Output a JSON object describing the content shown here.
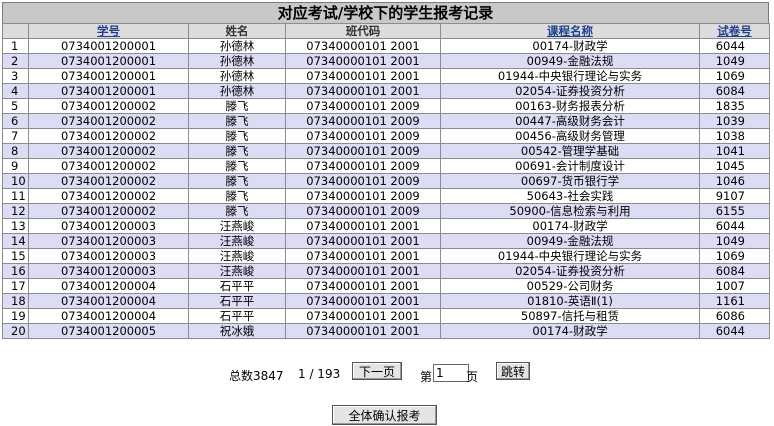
{
  "title": "对应考试/学校下的学生报考记录",
  "columns": {
    "no": "",
    "student_id": "学号",
    "name": "姓名",
    "class_code": "班代码",
    "course": "课程名称",
    "paper": "试卷号"
  },
  "rows": [
    {
      "no": "1",
      "student_id": "0734001200001",
      "name": "孙德林",
      "class_code": "07340000101 2001",
      "course": "00174-财政学",
      "paper": "6044"
    },
    {
      "no": "2",
      "student_id": "0734001200001",
      "name": "孙德林",
      "class_code": "07340000101 2001",
      "course": "00949-金融法规",
      "paper": "1049"
    },
    {
      "no": "3",
      "student_id": "0734001200001",
      "name": "孙德林",
      "class_code": "07340000101 2001",
      "course": "01944-中央银行理论与实务",
      "paper": "1069"
    },
    {
      "no": "4",
      "student_id": "0734001200001",
      "name": "孙德林",
      "class_code": "07340000101 2001",
      "course": "02054-证券投资分析",
      "paper": "6084"
    },
    {
      "no": "5",
      "student_id": "0734001200002",
      "name": "滕飞",
      "class_code": "07340000101 2009",
      "course": "00163-财务报表分析",
      "paper": "1835"
    },
    {
      "no": "6",
      "student_id": "0734001200002",
      "name": "滕飞",
      "class_code": "07340000101 2009",
      "course": "00447-高级财务会计",
      "paper": "1039"
    },
    {
      "no": "7",
      "student_id": "0734001200002",
      "name": "滕飞",
      "class_code": "07340000101 2009",
      "course": "00456-高级财务管理",
      "paper": "1038"
    },
    {
      "no": "8",
      "student_id": "0734001200002",
      "name": "滕飞",
      "class_code": "07340000101 2009",
      "course": "00542-管理学基础",
      "paper": "1041"
    },
    {
      "no": "9",
      "student_id": "0734001200002",
      "name": "滕飞",
      "class_code": "07340000101 2009",
      "course": "00691-会计制度设计",
      "paper": "1045"
    },
    {
      "no": "10",
      "student_id": "0734001200002",
      "name": "滕飞",
      "class_code": "07340000101 2009",
      "course": "00697-货币银行学",
      "paper": "1046"
    },
    {
      "no": "11",
      "student_id": "0734001200002",
      "name": "滕飞",
      "class_code": "07340000101 2009",
      "course": "50643-社会实践",
      "paper": "9107"
    },
    {
      "no": "12",
      "student_id": "0734001200002",
      "name": "滕飞",
      "class_code": "07340000101 2009",
      "course": "50900-信息检索与利用",
      "paper": "6155"
    },
    {
      "no": "13",
      "student_id": "0734001200003",
      "name": "汪燕峻",
      "class_code": "07340000101 2001",
      "course": "00174-财政学",
      "paper": "6044"
    },
    {
      "no": "14",
      "student_id": "0734001200003",
      "name": "汪燕峻",
      "class_code": "07340000101 2001",
      "course": "00949-金融法规",
      "paper": "1049"
    },
    {
      "no": "15",
      "student_id": "0734001200003",
      "name": "汪燕峻",
      "class_code": "07340000101 2001",
      "course": "01944-中央银行理论与实务",
      "paper": "1069"
    },
    {
      "no": "16",
      "student_id": "0734001200003",
      "name": "汪燕峻",
      "class_code": "07340000101 2001",
      "course": "02054-证券投资分析",
      "paper": "6084"
    },
    {
      "no": "17",
      "student_id": "0734001200004",
      "name": "石平平",
      "class_code": "07340000101 2001",
      "course": "00529-公司财务",
      "paper": "1007"
    },
    {
      "no": "18",
      "student_id": "0734001200004",
      "name": "石平平",
      "class_code": "07340000101 2001",
      "course": "01810-英语Ⅱ(1)",
      "paper": "1161"
    },
    {
      "no": "19",
      "student_id": "0734001200004",
      "name": "石平平",
      "class_code": "07340000101 2001",
      "course": "50897-信托与租赁",
      "paper": "6086"
    },
    {
      "no": "20",
      "student_id": "0734001200005",
      "name": "祝冰娥",
      "class_code": "07340000101 2001",
      "course": "00174-财政学",
      "paper": "6044"
    }
  ],
  "pager": {
    "total": "总数3847",
    "page_status": "1 / 193",
    "next_label": "下一页",
    "page_prefix": "第",
    "page_value": "1",
    "page_suffix": "页",
    "jump_label": "跳转"
  },
  "confirm_label": "全体确认报考",
  "colors": {
    "header_bg": "#c8c8c8",
    "row_alt": "#dcdcf5",
    "link": "#1f3f8f"
  }
}
